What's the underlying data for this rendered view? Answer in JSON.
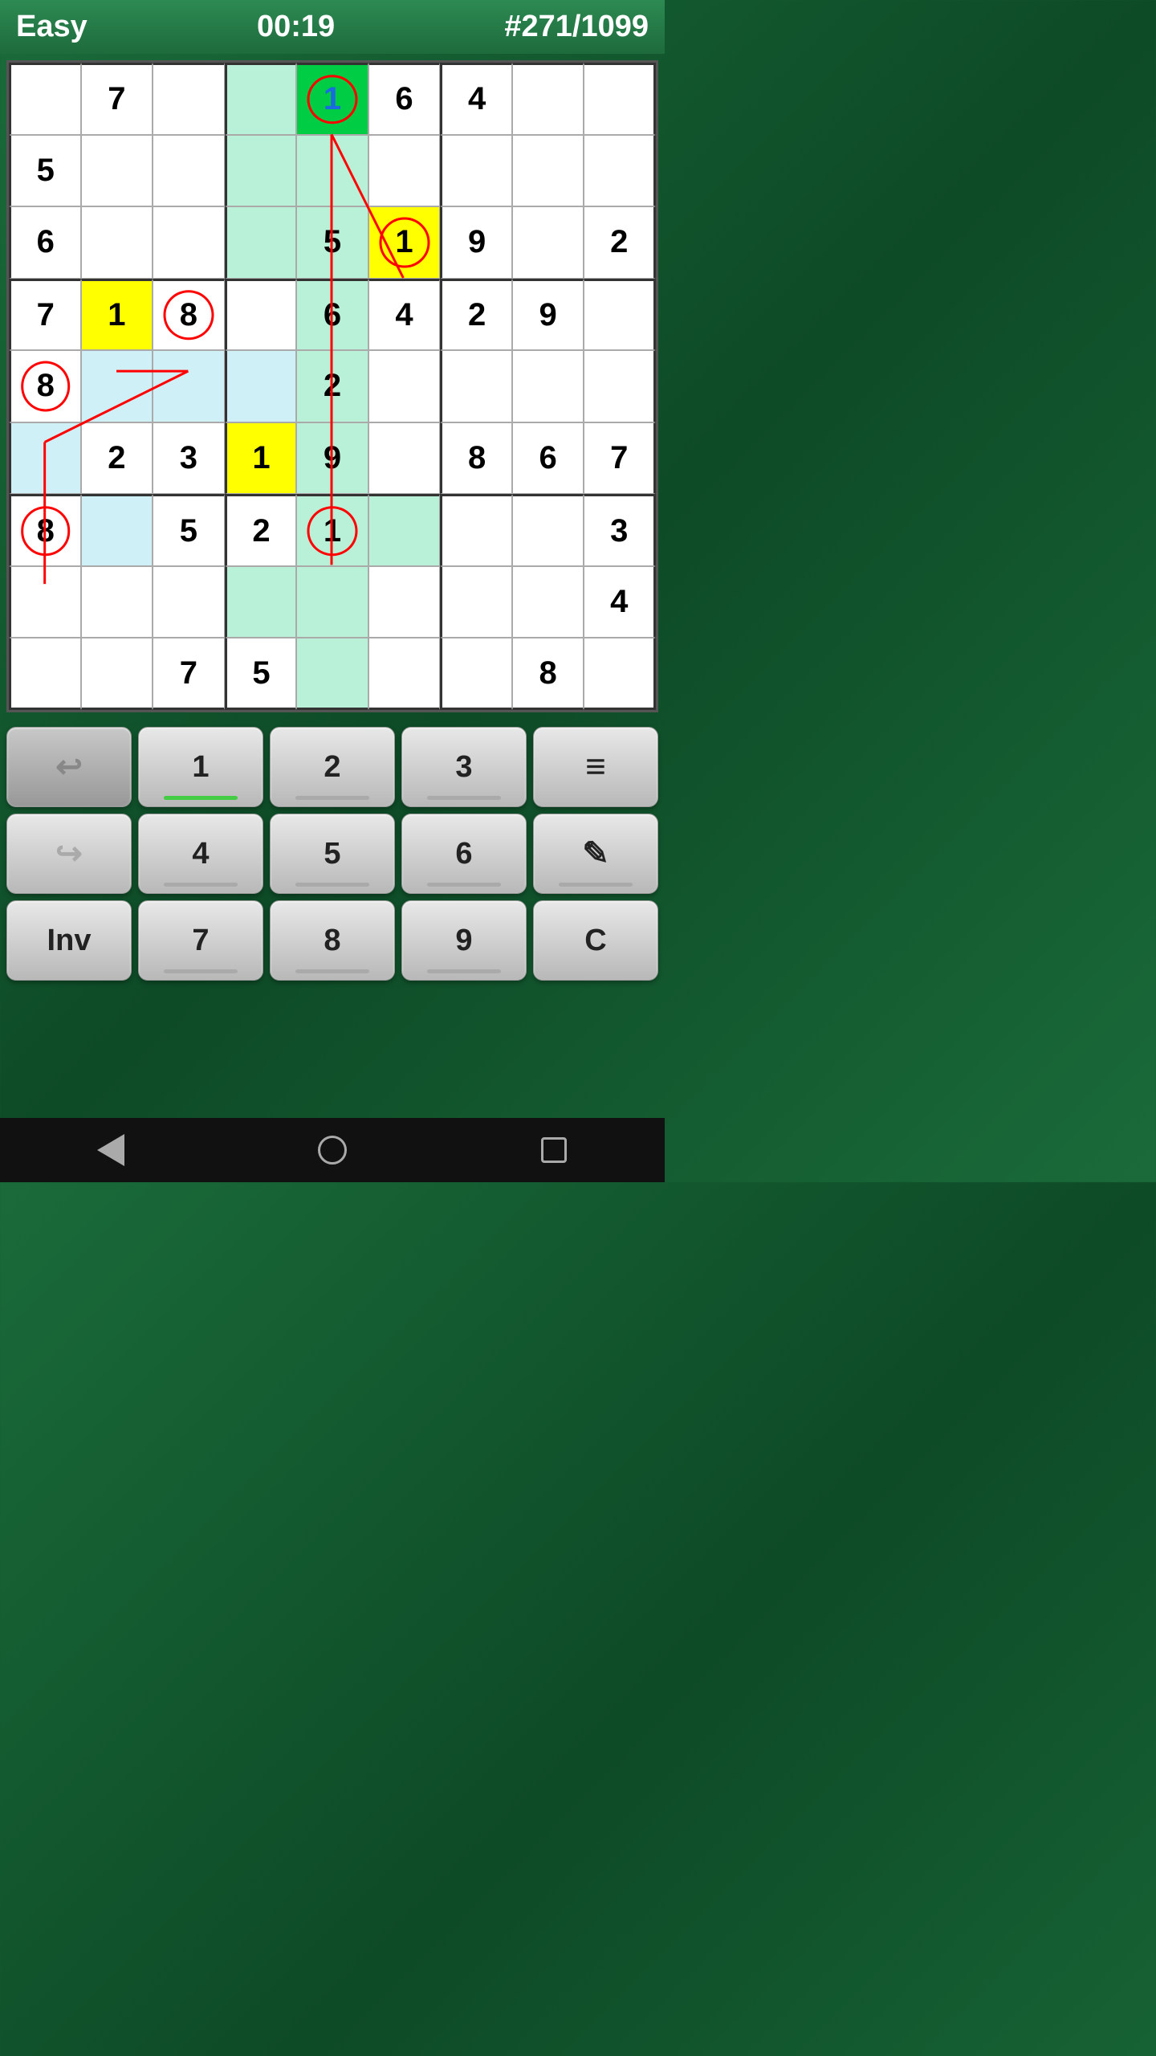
{
  "header": {
    "difficulty": "Easy",
    "timer": "00:19",
    "puzzle": "#271/1099"
  },
  "grid": {
    "cells": [
      [
        {
          "val": "",
          "bg": "normal"
        },
        {
          "val": "7",
          "bg": "normal"
        },
        {
          "val": "",
          "bg": "normal"
        },
        {
          "val": "",
          "bg": "col-highlight"
        },
        {
          "val": "1",
          "bg": "green",
          "color": "blue",
          "circle": true
        },
        {
          "val": "6",
          "bg": "normal"
        },
        {
          "val": "4",
          "bg": "normal"
        },
        {
          "val": "",
          "bg": "normal"
        },
        {
          "val": "",
          "bg": "normal"
        }
      ],
      [
        {
          "val": "5",
          "bg": "normal"
        },
        {
          "val": "",
          "bg": "normal"
        },
        {
          "val": "",
          "bg": "normal"
        },
        {
          "val": "",
          "bg": "col-highlight"
        },
        {
          "val": "",
          "bg": "col-highlight"
        },
        {
          "val": "",
          "bg": "normal"
        },
        {
          "val": "",
          "bg": "normal"
        },
        {
          "val": "",
          "bg": "normal"
        },
        {
          "val": "",
          "bg": "normal"
        }
      ],
      [
        {
          "val": "6",
          "bg": "normal"
        },
        {
          "val": "",
          "bg": "normal"
        },
        {
          "val": "",
          "bg": "normal"
        },
        {
          "val": "",
          "bg": "col-highlight"
        },
        {
          "val": "5",
          "bg": "col-highlight"
        },
        {
          "val": "1",
          "bg": "yellow",
          "circle": true
        },
        {
          "val": "9",
          "bg": "normal"
        },
        {
          "val": "",
          "bg": "normal"
        },
        {
          "val": "2",
          "bg": "normal"
        }
      ],
      [
        {
          "val": "7",
          "bg": "normal"
        },
        {
          "val": "1",
          "bg": "yellow"
        },
        {
          "val": "8",
          "bg": "normal",
          "circle": true
        },
        {
          "val": "",
          "bg": "normal"
        },
        {
          "val": "6",
          "bg": "col-highlight"
        },
        {
          "val": "4",
          "bg": "normal"
        },
        {
          "val": "2",
          "bg": "normal"
        },
        {
          "val": "9",
          "bg": "normal"
        },
        {
          "val": "",
          "bg": "normal"
        }
      ],
      [
        {
          "val": "8",
          "bg": "normal",
          "circle": true
        },
        {
          "val": "",
          "bg": "blue"
        },
        {
          "val": "",
          "bg": "blue"
        },
        {
          "val": "",
          "bg": "blue"
        },
        {
          "val": "2",
          "bg": "col-highlight"
        },
        {
          "val": "",
          "bg": "normal"
        },
        {
          "val": "",
          "bg": "normal"
        },
        {
          "val": "",
          "bg": "normal"
        },
        {
          "val": "",
          "bg": "normal"
        }
      ],
      [
        {
          "val": "",
          "bg": "blue"
        },
        {
          "val": "2",
          "bg": "normal"
        },
        {
          "val": "3",
          "bg": "normal"
        },
        {
          "val": "1",
          "bg": "yellow"
        },
        {
          "val": "9",
          "bg": "col-highlight"
        },
        {
          "val": "",
          "bg": "normal"
        },
        {
          "val": "8",
          "bg": "normal"
        },
        {
          "val": "6",
          "bg": "normal"
        },
        {
          "val": "7",
          "bg": "normal"
        }
      ],
      [
        {
          "val": "8",
          "bg": "normal",
          "circle": true
        },
        {
          "val": "",
          "bg": "blue"
        },
        {
          "val": "5",
          "bg": "normal"
        },
        {
          "val": "2",
          "bg": "normal"
        },
        {
          "val": "1",
          "bg": "col-highlight",
          "circle": true
        },
        {
          "val": "",
          "bg": "col-highlight"
        },
        {
          "val": "",
          "bg": "normal"
        },
        {
          "val": "",
          "bg": "normal"
        },
        {
          "val": "3",
          "bg": "normal"
        }
      ],
      [
        {
          "val": "",
          "bg": "normal"
        },
        {
          "val": "",
          "bg": "normal"
        },
        {
          "val": "",
          "bg": "normal"
        },
        {
          "val": "",
          "bg": "col-highlight"
        },
        {
          "val": "",
          "bg": "col-highlight"
        },
        {
          "val": "",
          "bg": "normal"
        },
        {
          "val": "",
          "bg": "normal"
        },
        {
          "val": "",
          "bg": "normal"
        },
        {
          "val": "4",
          "bg": "normal"
        }
      ],
      [
        {
          "val": "",
          "bg": "normal"
        },
        {
          "val": "",
          "bg": "normal"
        },
        {
          "val": "7",
          "bg": "normal"
        },
        {
          "val": "5",
          "bg": "normal"
        },
        {
          "val": "",
          "bg": "col-highlight"
        },
        {
          "val": "",
          "bg": "normal"
        },
        {
          "val": "",
          "bg": "normal"
        },
        {
          "val": "8",
          "bg": "normal"
        },
        {
          "val": "",
          "bg": "normal"
        }
      ]
    ]
  },
  "controls": {
    "row1": [
      {
        "type": "undo",
        "label": ""
      },
      {
        "type": "num",
        "label": "1",
        "indicator": "green"
      },
      {
        "type": "num",
        "label": "2",
        "indicator": "gray"
      },
      {
        "type": "num",
        "label": "3",
        "indicator": "gray"
      },
      {
        "type": "menu",
        "label": "≡"
      }
    ],
    "row2": [
      {
        "type": "redo",
        "label": ""
      },
      {
        "type": "num",
        "label": "4",
        "indicator": "gray"
      },
      {
        "type": "num",
        "label": "5",
        "indicator": "gray"
      },
      {
        "type": "num",
        "label": "6",
        "indicator": "gray"
      },
      {
        "type": "pencil",
        "label": "✎"
      }
    ],
    "row3": [
      {
        "type": "inv",
        "label": "Inv"
      },
      {
        "type": "num",
        "label": "7",
        "indicator": "gray"
      },
      {
        "type": "num",
        "label": "8",
        "indicator": "gray"
      },
      {
        "type": "num",
        "label": "9",
        "indicator": "gray"
      },
      {
        "type": "clear",
        "label": "C"
      }
    ]
  }
}
